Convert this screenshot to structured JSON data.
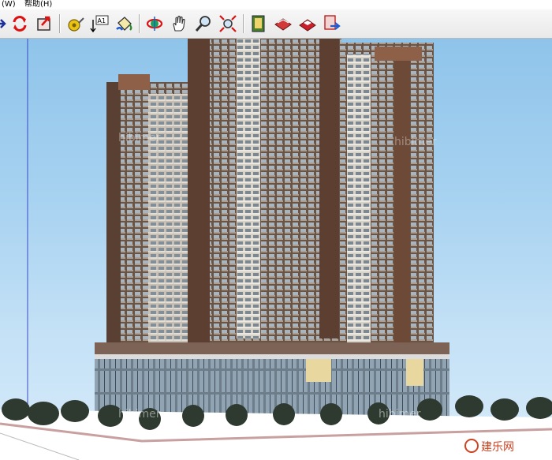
{
  "menubar": {
    "window_item": "(W)",
    "help_item": "帮助(H)"
  },
  "toolbar": {
    "buttons": [
      {
        "name": "select-arrow",
        "icon": "arrow-icon"
      },
      {
        "name": "orbit-refresh",
        "icon": "refresh-icon"
      },
      {
        "name": "push-pull",
        "icon": "pushpull-icon"
      },
      {
        "name": "tape-measure",
        "icon": "tape-measure-icon"
      },
      {
        "name": "text-label",
        "icon": "text-label-icon",
        "label": "A1"
      },
      {
        "name": "paint-bucket",
        "icon": "paint-bucket-icon"
      },
      {
        "name": "orbit",
        "icon": "orbit-icon"
      },
      {
        "name": "pan",
        "icon": "hand-icon"
      },
      {
        "name": "zoom",
        "icon": "zoom-icon"
      },
      {
        "name": "zoom-extents",
        "icon": "zoom-extents-icon"
      },
      {
        "name": "component-browser",
        "icon": "book-icon"
      },
      {
        "name": "materials",
        "icon": "materials-icon"
      },
      {
        "name": "styles",
        "icon": "styles-icon"
      },
      {
        "name": "export",
        "icon": "export-icon"
      }
    ]
  },
  "viewport": {
    "sky_color": "#a9d3f1",
    "watermark": "hibimer",
    "logo_text": "建乐网"
  }
}
